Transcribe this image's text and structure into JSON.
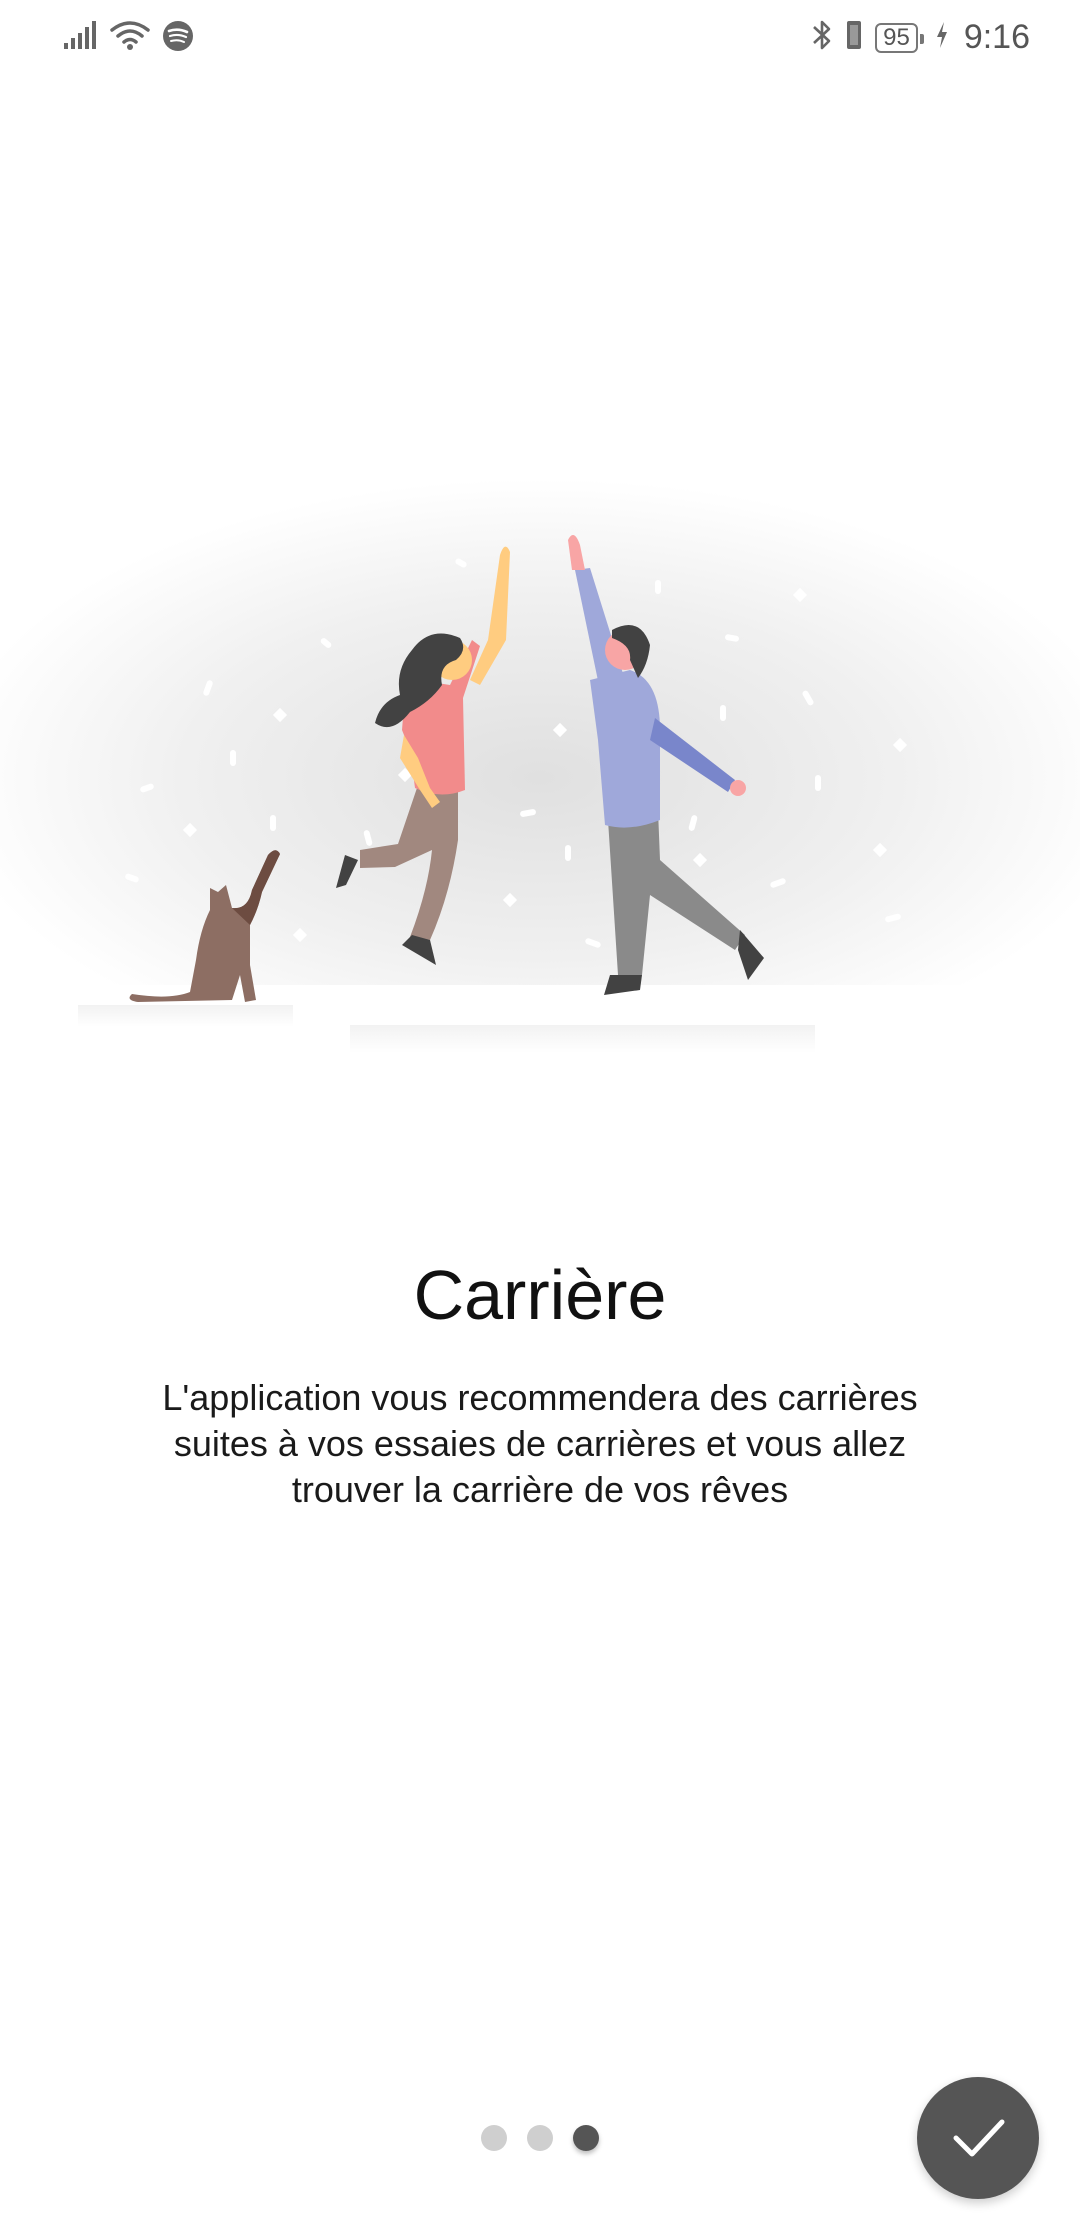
{
  "status_bar": {
    "left_icons": [
      "signal-icon",
      "wifi-icon",
      "spotify-icon"
    ],
    "right_icons": [
      "bluetooth-icon",
      "vibrate-icon",
      "charging-icon"
    ],
    "battery": "95",
    "time": "9:16"
  },
  "onboarding": {
    "title": "Carrière",
    "description": "L'application vous recommendera des carrières suites à vos essaies de carrières et vous allez trouver la carrière de vos rêves",
    "page_index": 3,
    "page_count": 3
  },
  "fab": {
    "icon": "check-icon"
  },
  "colors": {
    "accent": "#555555",
    "dot_inactive": "#cfcfcf",
    "woman_shirt": "#f28b8b",
    "man_shirt": "#9fa8da",
    "cat": "#8d6e63"
  }
}
